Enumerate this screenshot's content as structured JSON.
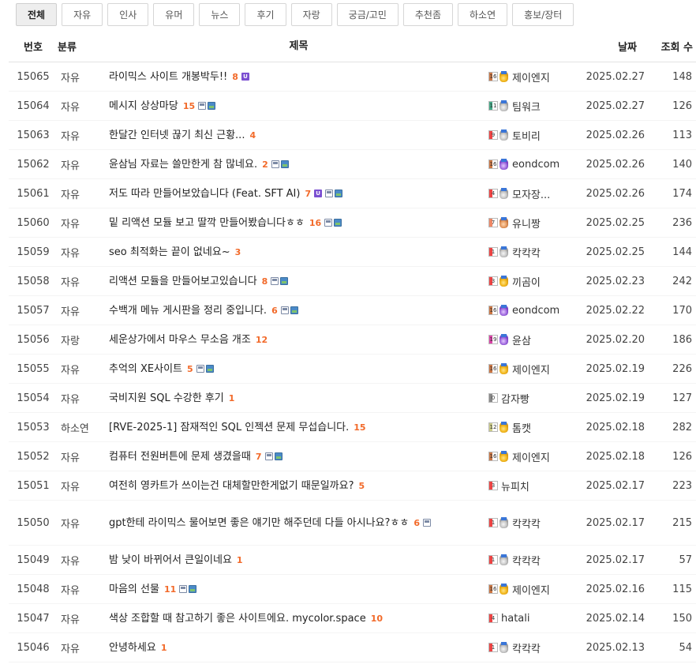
{
  "tabs": [
    {
      "label": "전체",
      "active": true
    },
    {
      "label": "자유"
    },
    {
      "label": "인사"
    },
    {
      "label": "유머"
    },
    {
      "label": "뉴스"
    },
    {
      "label": "후기"
    },
    {
      "label": "자랑"
    },
    {
      "label": "궁금/고민"
    },
    {
      "label": "추천좀"
    },
    {
      "label": "하소연"
    },
    {
      "label": "홍보/장터"
    }
  ],
  "header": {
    "no": "번호",
    "category": "분류",
    "title": "제목",
    "date": "날짜",
    "views": "조회 수"
  },
  "rows": [
    {
      "no": "15065",
      "category": "자유",
      "title": "라이믹스 사이트 개봉박두!!",
      "comments": "8",
      "icons": [
        "u"
      ],
      "level": "16",
      "medal": "gold",
      "author": "제이엔지",
      "date": "2025.02.27",
      "views": "148"
    },
    {
      "no": "15064",
      "category": "자유",
      "title": "메시지 상상마당",
      "comments": "15",
      "icons": [
        "file",
        "img"
      ],
      "level": "11",
      "medal": "silver",
      "author": "팀워크",
      "date": "2025.02.27",
      "views": "126"
    },
    {
      "no": "15063",
      "category": "자유",
      "title": "한달간 인터넷 끊기 최신 근황...",
      "comments": "4",
      "icons": [],
      "level": "9",
      "medal": "silver",
      "author": "토비리",
      "date": "2025.02.26",
      "views": "113"
    },
    {
      "no": "15062",
      "category": "자유",
      "title": "윤삼님 자료는 쓸만한게 참 많네요.",
      "comments": "2",
      "icons": [
        "file",
        "img"
      ],
      "level": "16",
      "medal": "purple",
      "author": "eondcom",
      "date": "2025.02.26",
      "views": "140"
    },
    {
      "no": "15061",
      "category": "자유",
      "title": "저도 따라 만들어보았습니다 (Feat. SFT AI)",
      "comments": "7",
      "icons": [
        "u",
        "file",
        "img"
      ],
      "level": "4",
      "medal": "silver",
      "author": "모자장...",
      "date": "2025.02.26",
      "views": "174"
    },
    {
      "no": "15060",
      "category": "자유",
      "title": "밑 리액션 모듈 보고 딸깍 만들어봤습니다ㅎㅎ",
      "comments": "16",
      "icons": [
        "file",
        "img"
      ],
      "level": "7",
      "medal": "bronze",
      "author": "유니짱",
      "date": "2025.02.25",
      "views": "236"
    },
    {
      "no": "15059",
      "category": "자유",
      "title": "seo 최적화는 끝이 없네요~",
      "comments": "3",
      "icons": [],
      "level": "1",
      "medal": "silver",
      "author": "칵칵칵",
      "date": "2025.02.25",
      "views": "144"
    },
    {
      "no": "15058",
      "category": "자유",
      "title": "리액션 모듈을 만들어보고있습니다",
      "comments": "8",
      "icons": [
        "file",
        "img"
      ],
      "level": "3",
      "medal": "gold",
      "author": "끼곰이",
      "date": "2025.02.23",
      "views": "242"
    },
    {
      "no": "15057",
      "category": "자유",
      "title": "수백개 메뉴 게시판을 정리 중입니다.",
      "comments": "6",
      "icons": [
        "file",
        "img"
      ],
      "level": "16",
      "medal": "purple",
      "author": "eondcom",
      "date": "2025.02.22",
      "views": "170"
    },
    {
      "no": "15056",
      "category": "자랑",
      "title": "세운상가에서 마우스 무소음 개조",
      "comments": "12",
      "icons": [],
      "level": "19",
      "medal": "purple",
      "author": "윤삼",
      "date": "2025.02.20",
      "views": "186"
    },
    {
      "no": "15055",
      "category": "자유",
      "title": "추억의 XE사이트",
      "comments": "5",
      "icons": [
        "file",
        "img"
      ],
      "level": "16",
      "medal": "gold",
      "author": "제이엔지",
      "date": "2025.02.19",
      "views": "226"
    },
    {
      "no": "15054",
      "category": "자유",
      "title": "국비지원 SQL 수강한 후기",
      "comments": "1",
      "icons": [],
      "level": "0",
      "medal": "none",
      "author": "감자빵",
      "date": "2025.02.19",
      "views": "127"
    },
    {
      "no": "15053",
      "category": "하소연",
      "title": "[RVE-2025-1] 잠재적인 SQL 인젝션 문제 무섭습니다.",
      "comments": "15",
      "icons": [],
      "level": "12",
      "medal": "gold",
      "author": "톰캣",
      "date": "2025.02.18",
      "views": "282"
    },
    {
      "no": "15052",
      "category": "자유",
      "title": "컴퓨터 전원버튼에 문제 생겼을때",
      "comments": "7",
      "icons": [
        "file",
        "img"
      ],
      "level": "16",
      "medal": "gold",
      "author": "제이엔지",
      "date": "2025.02.18",
      "views": "126"
    },
    {
      "no": "15051",
      "category": "자유",
      "title": "여전히 영카트가 쓰이는건 대체할만한게없기 때문일까요?",
      "comments": "5",
      "icons": [],
      "level": "3",
      "medal": "none",
      "author": "뉴피치",
      "date": "2025.02.17",
      "views": "223"
    },
    {
      "no": "15050",
      "category": "자유",
      "title": "gpt한테 라이믹스 물어보면 좋은 얘기만 해주던데 다들 아시나요?ㅎㅎ",
      "comments": "6",
      "icons": [
        "file"
      ],
      "level": "1",
      "medal": "silver",
      "author": "칵칵칵",
      "date": "2025.02.17",
      "views": "215",
      "tall": true
    },
    {
      "no": "15049",
      "category": "자유",
      "title": "밤 낮이 바뀌어서 큰일이네요",
      "comments": "1",
      "icons": [],
      "level": "1",
      "medal": "silver",
      "author": "칵칵칵",
      "date": "2025.02.17",
      "views": "57"
    },
    {
      "no": "15048",
      "category": "자유",
      "title": "마음의 선물",
      "comments": "11",
      "icons": [
        "file",
        "img"
      ],
      "level": "16",
      "medal": "gold",
      "author": "제이엔지",
      "date": "2025.02.16",
      "views": "115"
    },
    {
      "no": "15047",
      "category": "자유",
      "title": "색상 조합할 때 참고하기 좋은 사이트에요. mycolor.space",
      "comments": "10",
      "icons": [],
      "level": "4",
      "medal": "none",
      "author": "hatali",
      "date": "2025.02.14",
      "views": "150"
    },
    {
      "no": "15046",
      "category": "자유",
      "title": "안녕하세요",
      "comments": "1",
      "icons": [],
      "level": "1",
      "medal": "silver",
      "author": "칵칵칵",
      "date": "2025.02.13",
      "views": "54"
    }
  ]
}
